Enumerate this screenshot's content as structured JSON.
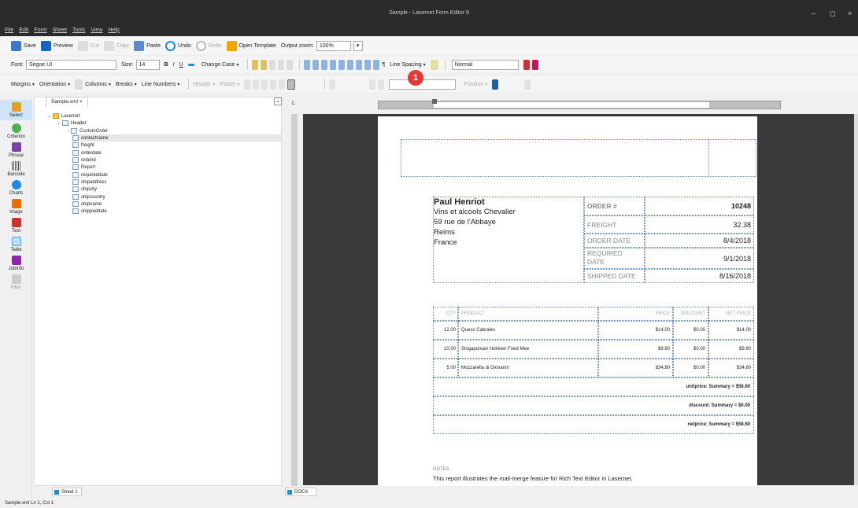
{
  "app": {
    "title": "Sample - Lasernet Form Editor 9"
  },
  "window_controls": {
    "min": "–",
    "max": "◻",
    "close": "×"
  },
  "menu": [
    "File",
    "Edit",
    "Form",
    "Sheet",
    "Tools",
    "View",
    "Help"
  ],
  "toolbar1": {
    "save": "Save",
    "preview": "Preview",
    "cut": "Cut",
    "copy": "Copy",
    "paste": "Paste",
    "undo": "Undo",
    "redo": "Redo",
    "open_template": "Open Template",
    "output_zoom_label": "Output zoom:",
    "output_zoom_value": "100%"
  },
  "toolbar2": {
    "font_label": "Font:",
    "font_value": "Segoe UI",
    "size_label": "Size:",
    "size_value": "14",
    "bold": "B",
    "italic": "I",
    "underline": "U",
    "change_case": "Change Case",
    "line_spacing": "Line Spacing",
    "paragraph_mark": "¶",
    "style_value": "Normal"
  },
  "toolbar3": {
    "margins": "Margins",
    "orientation": "Orientation",
    "columns": "Columns",
    "breaks": "Breaks",
    "line_numbers": "Line Numbers",
    "header": "Header",
    "footer": "Footer",
    "position": "Position"
  },
  "badge": "1",
  "toolbox": [
    {
      "label": "Select",
      "color": "#e8a020"
    },
    {
      "label": "Criterion",
      "color": "#4caf50"
    },
    {
      "label": "Phrase",
      "color": "#7b3fb0"
    },
    {
      "label": "Barcode",
      "color": "#555555"
    },
    {
      "label": "Charts",
      "color": "#1e88e5"
    },
    {
      "label": "Image",
      "color": "#ef6c00"
    },
    {
      "label": "Text",
      "color": "#d32f2f"
    },
    {
      "label": "Table",
      "color": "#42a5f5"
    },
    {
      "label": "JobInfo",
      "color": "#8e24aa"
    },
    {
      "label": "Filter",
      "color": "#aaaaaa"
    }
  ],
  "tree": {
    "tab": "Sample.xml ×",
    "root": "Lasernet",
    "header": "Header",
    "items": [
      "CustomOrder",
      "contactname",
      "freight",
      "orderdate",
      "orderid",
      "Report",
      "requireddate",
      "shipaddress",
      "shipcity",
      "shipcountry",
      "shipname",
      "shippeddate"
    ]
  },
  "doc": {
    "address": {
      "name": "Paul Henriot",
      "line1": "Vins et alcools Chevalier",
      "line2": "59 rue de l'Abbaye",
      "line3": "Reims",
      "line4": "France"
    },
    "order": {
      "order_label": "ORDER #",
      "order_value": "10248",
      "freight_label": "FREIGHT",
      "freight_value": "32.38",
      "orderdate_label": "ORDER DATE",
      "orderdate_value": "8/4/2018",
      "requireddate_label": "REQUIRED DATE",
      "requireddate_value": "9/1/2018",
      "shippeddate_label": "SHIPPED DATE",
      "shippeddate_value": "8/16/2018"
    },
    "table": {
      "headers": {
        "qty": "QTY",
        "product": "PRODUCT",
        "price": "PRICE",
        "discount": "DISCOUNT",
        "net": "NET PRICE"
      },
      "rows": [
        {
          "qty": "12.00",
          "product": "Queso Cabrales",
          "price": "$14.00",
          "discount": "$0.00",
          "net": "$14.00"
        },
        {
          "qty": "10.00",
          "product": "Singaporean Hokkien Fried Mee",
          "price": "$9.80",
          "discount": "$0.00",
          "net": "$9.80"
        },
        {
          "qty": "5.00",
          "product": "Mozzarella di Giovanni",
          "price": "$34.80",
          "discount": "$0.00",
          "net": "$34.80"
        }
      ],
      "summary1": "unitprice: Summary = $58.60",
      "summary2": "discount: Summary = $0.00",
      "summary3": "netprice: Summary = $58.60"
    },
    "notes_label": "NOTES",
    "notes_text": "This report illustrates the mail-merge feature for Rich Text Editor in Lasernet."
  },
  "tabs": {
    "sheet": "Sheet 1",
    "docx": "DOCX"
  },
  "status": "Sample.xml  Ln 1, Col 1"
}
